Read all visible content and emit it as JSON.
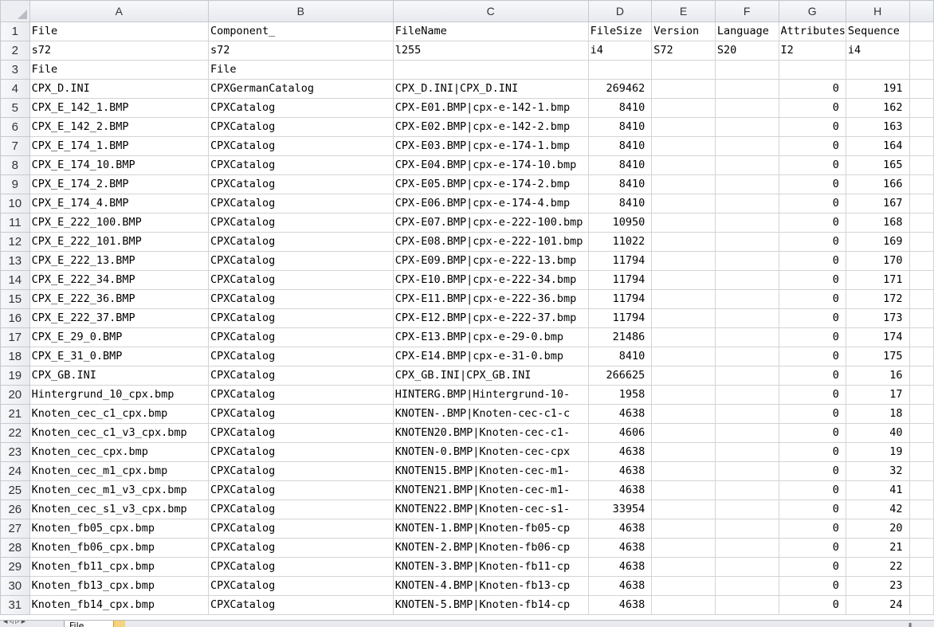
{
  "columns": [
    "A",
    "B",
    "C",
    "D",
    "E",
    "F",
    "G",
    "H"
  ],
  "numeric_columns": [
    3,
    6,
    7
  ],
  "rows": [
    {
      "n": "1",
      "c": [
        "File",
        "Component_",
        "FileName",
        "FileSize",
        "Version",
        "Language",
        "Attributes",
        "Sequence"
      ]
    },
    {
      "n": "2",
      "c": [
        "s72",
        "s72",
        "l255",
        "i4",
        "S72",
        "S20",
        "I2",
        "i4"
      ]
    },
    {
      "n": "3",
      "c": [
        "File",
        "File",
        "",
        "",
        "",
        "",
        "",
        ""
      ]
    },
    {
      "n": "4",
      "c": [
        "CPX_D.INI",
        "CPXGermanCatalog",
        "CPX_D.INI|CPX_D.INI",
        "269462",
        "",
        "",
        "0",
        "191"
      ]
    },
    {
      "n": "5",
      "c": [
        "CPX_E_142_1.BMP",
        "CPXCatalog",
        "CPX-E01.BMP|cpx-e-142-1.bmp",
        "8410",
        "",
        "",
        "0",
        "162"
      ]
    },
    {
      "n": "6",
      "c": [
        "CPX_E_142_2.BMP",
        "CPXCatalog",
        "CPX-E02.BMP|cpx-e-142-2.bmp",
        "8410",
        "",
        "",
        "0",
        "163"
      ]
    },
    {
      "n": "7",
      "c": [
        "CPX_E_174_1.BMP",
        "CPXCatalog",
        "CPX-E03.BMP|cpx-e-174-1.bmp",
        "8410",
        "",
        "",
        "0",
        "164"
      ]
    },
    {
      "n": "8",
      "c": [
        "CPX_E_174_10.BMP",
        "CPXCatalog",
        "CPX-E04.BMP|cpx-e-174-10.bmp",
        "8410",
        "",
        "",
        "0",
        "165"
      ]
    },
    {
      "n": "9",
      "c": [
        "CPX_E_174_2.BMP",
        "CPXCatalog",
        "CPX-E05.BMP|cpx-e-174-2.bmp",
        "8410",
        "",
        "",
        "0",
        "166"
      ]
    },
    {
      "n": "10",
      "c": [
        "CPX_E_174_4.BMP",
        "CPXCatalog",
        "CPX-E06.BMP|cpx-e-174-4.bmp",
        "8410",
        "",
        "",
        "0",
        "167"
      ]
    },
    {
      "n": "11",
      "c": [
        "CPX_E_222_100.BMP",
        "CPXCatalog",
        "CPX-E07.BMP|cpx-e-222-100.bmp",
        "10950",
        "",
        "",
        "0",
        "168"
      ]
    },
    {
      "n": "12",
      "c": [
        "CPX_E_222_101.BMP",
        "CPXCatalog",
        "CPX-E08.BMP|cpx-e-222-101.bmp",
        "11022",
        "",
        "",
        "0",
        "169"
      ]
    },
    {
      "n": "13",
      "c": [
        "CPX_E_222_13.BMP",
        "CPXCatalog",
        "CPX-E09.BMP|cpx-e-222-13.bmp",
        "11794",
        "",
        "",
        "0",
        "170"
      ]
    },
    {
      "n": "14",
      "c": [
        "CPX_E_222_34.BMP",
        "CPXCatalog",
        "CPX-E10.BMP|cpx-e-222-34.bmp",
        "11794",
        "",
        "",
        "0",
        "171"
      ]
    },
    {
      "n": "15",
      "c": [
        "CPX_E_222_36.BMP",
        "CPXCatalog",
        "CPX-E11.BMP|cpx-e-222-36.bmp",
        "11794",
        "",
        "",
        "0",
        "172"
      ]
    },
    {
      "n": "16",
      "c": [
        "CPX_E_222_37.BMP",
        "CPXCatalog",
        "CPX-E12.BMP|cpx-e-222-37.bmp",
        "11794",
        "",
        "",
        "0",
        "173"
      ]
    },
    {
      "n": "17",
      "c": [
        "CPX_E_29_0.BMP",
        "CPXCatalog",
        "CPX-E13.BMP|cpx-e-29-0.bmp",
        "21486",
        "",
        "",
        "0",
        "174"
      ]
    },
    {
      "n": "18",
      "c": [
        "CPX_E_31_0.BMP",
        "CPXCatalog",
        "CPX-E14.BMP|cpx-e-31-0.bmp",
        "8410",
        "",
        "",
        "0",
        "175"
      ]
    },
    {
      "n": "19",
      "c": [
        "CPX_GB.INI",
        "CPXCatalog",
        "CPX_GB.INI|CPX_GB.INI",
        "266625",
        "",
        "",
        "0",
        "16"
      ]
    },
    {
      "n": "20",
      "c": [
        "Hintergrund_10_cpx.bmp",
        "CPXCatalog",
        "HINTERG.BMP|Hintergrund-10-",
        "1958",
        "",
        "",
        "0",
        "17"
      ]
    },
    {
      "n": "21",
      "c": [
        "Knoten_cec_c1_cpx.bmp",
        "CPXCatalog",
        "KNOTEN-.BMP|Knoten-cec-c1-c",
        "4638",
        "",
        "",
        "0",
        "18"
      ]
    },
    {
      "n": "22",
      "c": [
        "Knoten_cec_c1_v3_cpx.bmp",
        "CPXCatalog",
        "KNOTEN20.BMP|Knoten-cec-c1-",
        "4606",
        "",
        "",
        "0",
        "40"
      ]
    },
    {
      "n": "23",
      "c": [
        "Knoten_cec_cpx.bmp",
        "CPXCatalog",
        "KNOTEN-0.BMP|Knoten-cec-cpx",
        "4638",
        "",
        "",
        "0",
        "19"
      ]
    },
    {
      "n": "24",
      "c": [
        "Knoten_cec_m1_cpx.bmp",
        "CPXCatalog",
        "KNOTEN15.BMP|Knoten-cec-m1-",
        "4638",
        "",
        "",
        "0",
        "32"
      ]
    },
    {
      "n": "25",
      "c": [
        "Knoten_cec_m1_v3_cpx.bmp",
        "CPXCatalog",
        "KNOTEN21.BMP|Knoten-cec-m1-",
        "4638",
        "",
        "",
        "0",
        "41"
      ]
    },
    {
      "n": "26",
      "c": [
        "Knoten_cec_s1_v3_cpx.bmp",
        "CPXCatalog",
        "KNOTEN22.BMP|Knoten-cec-s1-",
        "33954",
        "",
        "",
        "0",
        "42"
      ]
    },
    {
      "n": "27",
      "c": [
        "Knoten_fb05_cpx.bmp",
        "CPXCatalog",
        "KNOTEN-1.BMP|Knoten-fb05-cp",
        "4638",
        "",
        "",
        "0",
        "20"
      ]
    },
    {
      "n": "28",
      "c": [
        "Knoten_fb06_cpx.bmp",
        "CPXCatalog",
        "KNOTEN-2.BMP|Knoten-fb06-cp",
        "4638",
        "",
        "",
        "0",
        "21"
      ]
    },
    {
      "n": "29",
      "c": [
        "Knoten_fb11_cpx.bmp",
        "CPXCatalog",
        "KNOTEN-3.BMP|Knoten-fb11-cp",
        "4638",
        "",
        "",
        "0",
        "22"
      ]
    },
    {
      "n": "30",
      "c": [
        "Knoten_fb13_cpx.bmp",
        "CPXCatalog",
        "KNOTEN-4.BMP|Knoten-fb13-cp",
        "4638",
        "",
        "",
        "0",
        "23"
      ]
    },
    {
      "n": "31",
      "c": [
        "Knoten_fb14_cpx.bmp",
        "CPXCatalog",
        "KNOTEN-5.BMP|Knoten-fb14-cp",
        "4638",
        "",
        "",
        "0",
        "24"
      ]
    }
  ],
  "sheet_tabs": [
    "File"
  ],
  "icons": {
    "corner": "select-all-icon",
    "tab_nav": "tab-navigation-arrows-icon",
    "new_sheet": "new-sheet-icon"
  }
}
